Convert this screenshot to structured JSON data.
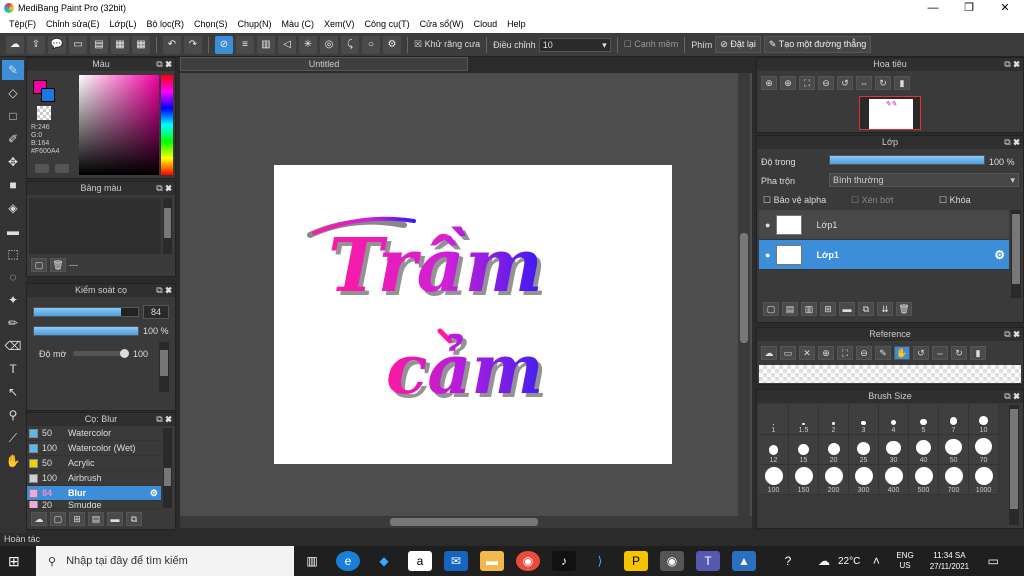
{
  "window": {
    "title": "MediBang Paint Pro (32bit)",
    "minimize": "—",
    "maximize": "❐",
    "close": "✕"
  },
  "menu": [
    "Tệp(F)",
    "Chỉnh sửa(E)",
    "Lớp(L)",
    "Bộ lọc(R)",
    "Chọn(S)",
    "Chụp(N)",
    "Màu (C)",
    "Xem(V)",
    "Công cụ(T)",
    "Cửa sổ(W)",
    "Cloud",
    "Help"
  ],
  "toolbar": {
    "antialias_label": "Khử răng cưa",
    "adjust_label": "Điều chỉnh",
    "adjust_value": "10",
    "edge_label": "Cạnh mềm",
    "key_label": "Phím",
    "reset_label": "Đặt lại",
    "straight_label": "Tạo một đường thẳng"
  },
  "color_panel": {
    "title": "Màu",
    "r": "R:246",
    "g": "G:0",
    "b": "B:164",
    "hex": "#F600A4",
    "primary": "#F600A4"
  },
  "palette_panel": {
    "title": "Bảng màu",
    "dash": "---"
  },
  "brush_control": {
    "title": "Kiểm soát cọ",
    "size": "84",
    "opacity": "100 %",
    "density_label": "Độ mờ",
    "density": "100"
  },
  "brush_panel": {
    "title": "Cọ: Blur",
    "items": [
      {
        "size": "50",
        "name": "Watercolor",
        "color": "#5ab8f0"
      },
      {
        "size": "100",
        "name": "Watercolor (Wet)",
        "color": "#5ab8f0"
      },
      {
        "size": "50",
        "name": "Acrylic",
        "color": "#f0d000"
      },
      {
        "size": "100",
        "name": "Airbrush",
        "color": "#d0d0d0"
      },
      {
        "size": "84",
        "name": "Blur",
        "color": "#f0a8d8"
      },
      {
        "size": "20",
        "name": "Smudge",
        "color": "#f0a8d8"
      }
    ]
  },
  "canvas": {
    "tab": "Untitled",
    "line1": "Trầm",
    "line2": "cảm"
  },
  "navigator": {
    "title": "Hoa tiêu"
  },
  "layers": {
    "title": "Lớp",
    "opacity_label": "Độ trong",
    "opacity": "100 %",
    "blend_label": "Pha trộn",
    "blend": "Bình thường",
    "protect": "Bảo vệ alpha",
    "clip": "Xén bớt",
    "lock": "Khóa",
    "items": [
      {
        "name": "Lớp1"
      },
      {
        "name": "Lớp1"
      }
    ]
  },
  "reference": {
    "title": "Reference"
  },
  "brush_size": {
    "title": "Brush Size",
    "sizes": [
      "1",
      "1.5",
      "2",
      "3",
      "4",
      "5",
      "7",
      "10",
      "12",
      "15",
      "20",
      "25",
      "30",
      "40",
      "50",
      "70",
      "100",
      "150",
      "200",
      "300",
      "400",
      "500",
      "700",
      "1000"
    ]
  },
  "status": "Hoàn tác",
  "taskbar": {
    "search": "Nhập tại đây để tìm kiếm",
    "temp": "22°C",
    "lang1": "ENG",
    "lang2": "US",
    "time": "11:34 SA",
    "date": "27/11/2021"
  }
}
